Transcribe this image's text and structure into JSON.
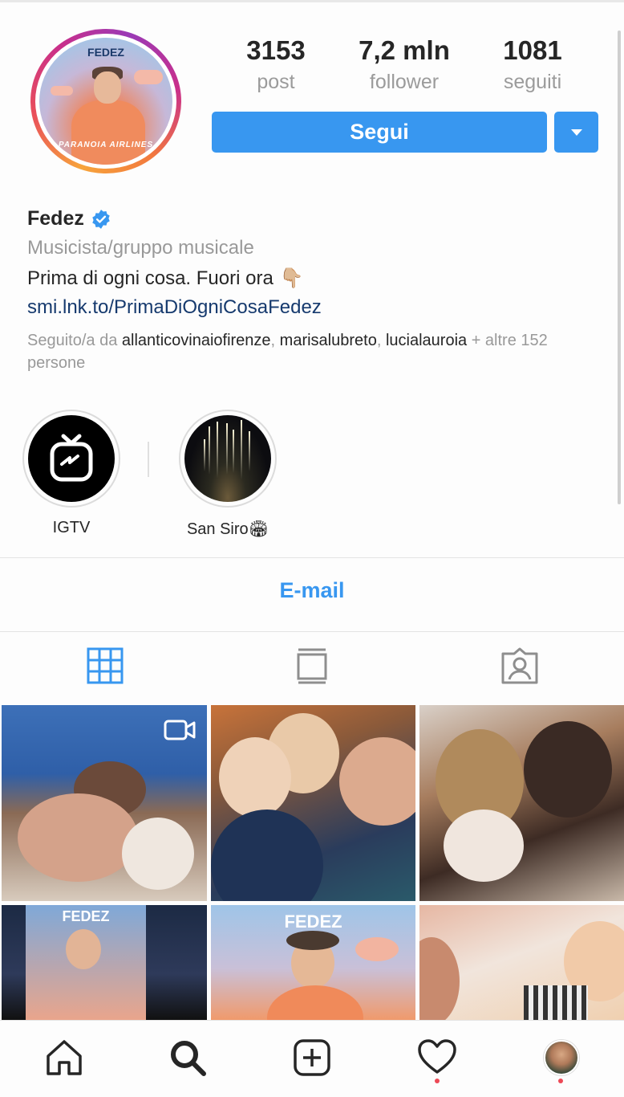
{
  "profile": {
    "avatar_brand": "FEDEZ",
    "avatar_album": "PARANOIA AIRLINES",
    "stats": [
      {
        "value": "3153",
        "label": "post"
      },
      {
        "value": "7,2 mln",
        "label": "follower"
      },
      {
        "value": "1081",
        "label": "seguiti"
      }
    ],
    "follow_label": "Segui",
    "name": "Fedez",
    "category": "Musicista/gruppo musicale",
    "bio": "Prima di ogni cosa. Fuori ora",
    "bio_emoji": "👇🏼",
    "link": "smi.lnk.to/PrimaDiOgniCosaFedez",
    "followed_by_prefix": "Seguito/a da ",
    "followed_by_1": "allanticovinaiofirenze",
    "followed_by_sep1": ", ",
    "followed_by_2": "marisalubreto",
    "followed_by_sep2": ", ",
    "followed_by_3": "lucialauroia",
    "followed_by_suffix": " + altre 152 persone"
  },
  "highlights": [
    {
      "label": "IGTV"
    },
    {
      "label": "San Siro🏟"
    }
  ],
  "contact": {
    "email_label": "E-mail"
  },
  "tabs": [
    {
      "icon": "grid-icon",
      "active": true
    },
    {
      "icon": "feed-icon",
      "active": false
    },
    {
      "icon": "tagged-icon",
      "active": false
    }
  ],
  "grid_posts": [
    {
      "brand": "",
      "video": true
    },
    {
      "brand": "",
      "video": false
    },
    {
      "brand": "",
      "video": false
    },
    {
      "brand": "FEDEZ",
      "video": false
    },
    {
      "brand": "FEDEZ",
      "video": false
    },
    {
      "brand": "",
      "video": false
    }
  ],
  "bottom_nav": [
    "home-icon",
    "search-icon",
    "new-post-icon",
    "activity-icon",
    "profile-icon"
  ],
  "colors": {
    "accent": "#3897f0",
    "text": "#262626",
    "muted": "#999999",
    "notification": "#ed4956"
  }
}
